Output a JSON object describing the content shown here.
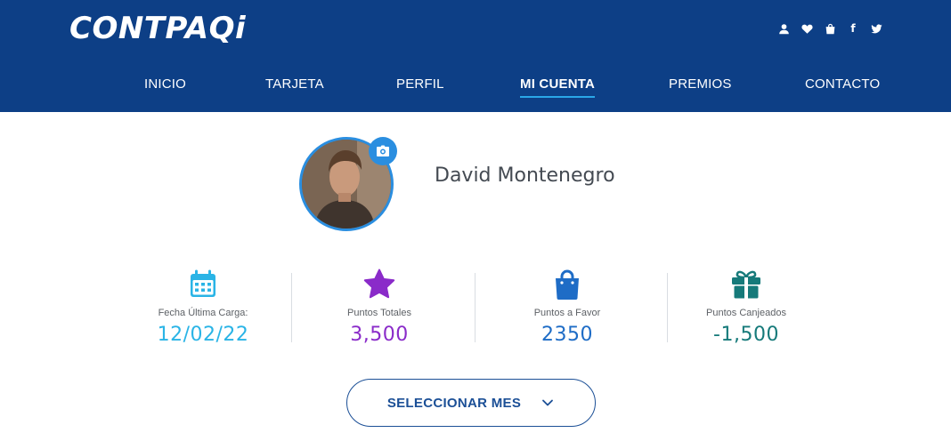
{
  "brand": {
    "logo_text": "CONTPAQi"
  },
  "colors": {
    "header_bg": "#0d3f86",
    "accent": "#2aa7e8",
    "date": "#2ab4e6",
    "points_total": "#8a2bc9",
    "points_favor": "#1e6cc6",
    "points_redeemed": "#167a7a"
  },
  "social": [
    {
      "name": "user-icon"
    },
    {
      "name": "heart-icon"
    },
    {
      "name": "bag-icon"
    },
    {
      "name": "facebook-icon",
      "text": "f"
    },
    {
      "name": "twitter-icon"
    }
  ],
  "nav": {
    "items": [
      {
        "label": "INICIO"
      },
      {
        "label": "TARJETA"
      },
      {
        "label": "PERFIL"
      },
      {
        "label": "MI CUENTA",
        "active": true
      },
      {
        "label": "PREMIOS"
      },
      {
        "label": "CONTACTO"
      }
    ]
  },
  "profile": {
    "name": "David Montenegro",
    "avatar_icon": "user-photo",
    "camera_icon": "camera-icon"
  },
  "stats": [
    {
      "icon": "calendar-icon",
      "label": "Fecha Última Carga:",
      "value": "12/02/22"
    },
    {
      "icon": "star-icon",
      "label": "Puntos Totales",
      "value": "3,500"
    },
    {
      "icon": "shopping-bag-icon",
      "label": "Puntos a Favor",
      "value": "2350"
    },
    {
      "icon": "gift-icon",
      "label": "Puntos Canjeados",
      "value": "-1,500"
    }
  ],
  "month_selector": {
    "label": "SELECCIONAR MES",
    "icon": "chevron-down-icon"
  }
}
